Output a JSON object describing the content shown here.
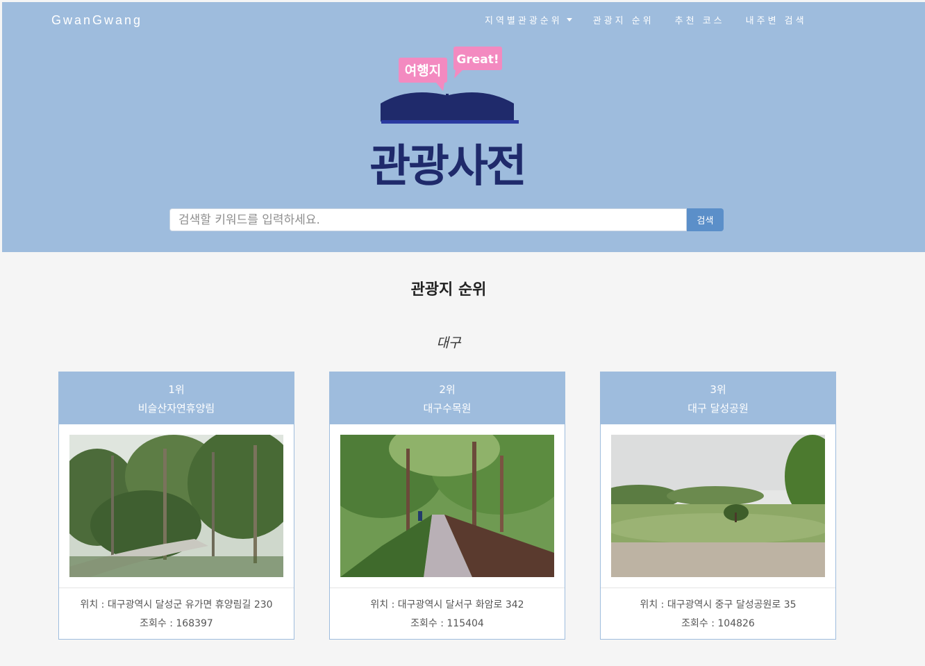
{
  "navbar": {
    "brand": "GwanGwang",
    "items": [
      {
        "label": "지역별관광순위",
        "dropdown": true
      },
      {
        "label": "관광지 순위"
      },
      {
        "label": "추천 코스"
      },
      {
        "label": "내주변 검색"
      }
    ]
  },
  "logo": {
    "bubble_left": "여행지",
    "bubble_right": "Great!",
    "title": "관광사전"
  },
  "search": {
    "placeholder": "검색할 키워드를 입력하세요.",
    "button_label": "검색"
  },
  "section": {
    "title": "관광지 순위",
    "region": "대구"
  },
  "cards": [
    {
      "rank": "1위",
      "name": "비슬산자연휴양림",
      "location": "위치 : 대구광역시 달성군 유가면 휴양림길 230",
      "views": "조회수 : 168397"
    },
    {
      "rank": "2위",
      "name": "대구수목원",
      "location": "위치 : 대구광역시 달서구 화암로 342",
      "views": "조회수 : 115404"
    },
    {
      "rank": "3위",
      "name": "대구 달성공원",
      "location": "위치 : 대구광역시 중구 달성공원로 35",
      "views": "조회수 : 104826"
    }
  ],
  "colors": {
    "header_bg": "#9ebcdd",
    "search_button": "#5b8fc9",
    "logo_navy": "#1f2a6b",
    "bubble_pink": "#f38ac0"
  }
}
